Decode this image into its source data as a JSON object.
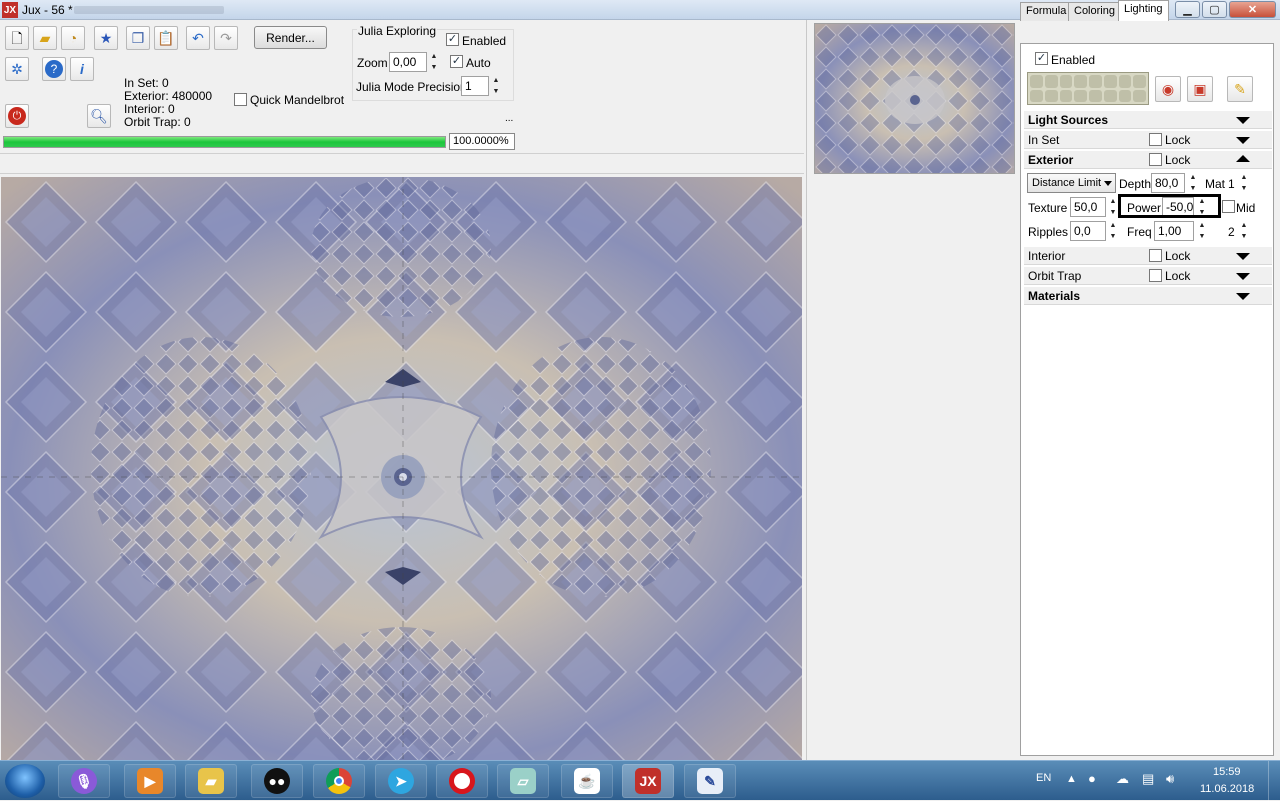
{
  "window": {
    "title": "Jux - 56 *",
    "logo": "JX"
  },
  "toolbar": {
    "render_label": "Render...",
    "icons": [
      "new-file-icon",
      "open-folder-icon",
      "open-recent-icon",
      "save-icon",
      "copy-icon",
      "paste-icon",
      "undo-icon",
      "redo-icon",
      "settings-icon",
      "help-icon",
      "info-icon",
      "power-icon",
      "zoom-tool-icon"
    ]
  },
  "stats": {
    "in_set": "In Set: 0",
    "exterior": "Exterior: 480000",
    "interior": "Interior: 0",
    "orbit_trap": "Orbit Trap: 0"
  },
  "quick_mandelbrot": {
    "label": "Quick Mandelbrot",
    "checked": false
  },
  "julia": {
    "title": "Julia Exploring",
    "enabled_label": "Enabled",
    "zoom_label": "Zoom",
    "zoom_value": "0,00",
    "auto_label": "Auto",
    "precision_label": "Julia Mode Precision",
    "precision_value": "1",
    "more": "..."
  },
  "progress": {
    "percent": 100,
    "text": "100.0000%"
  },
  "tabs": [
    "Formula",
    "Coloring",
    "Lighting"
  ],
  "active_tab": "Lighting",
  "lighting": {
    "enabled_label": "Enabled",
    "sections": {
      "light_sources": "Light Sources",
      "in_set": "In Set",
      "exterior": "Exterior",
      "interior": "Interior",
      "orbit_trap": "Orbit Trap",
      "materials": "Materials",
      "lock": "Lock"
    },
    "exterior": {
      "method": "Distance Limit",
      "depth_label": "Depth",
      "depth_value": "80,0",
      "mat_label": "Mat",
      "mat_value": "1",
      "texture_label": "Texture",
      "texture_value": "50,0",
      "power_label": "Power",
      "power_value": "-50,0",
      "mid_label": "Mid",
      "ripples_label": "Ripples",
      "ripples_value": "0,0",
      "freq_label": "Freq",
      "freq_value": "1,00",
      "freq2_value": "2"
    }
  },
  "tray": {
    "lang": "EN",
    "time": "15:59",
    "date": "11.06.2018"
  },
  "colors": {
    "accent": "#1cc63c",
    "taskbar": "#2d5d8d"
  }
}
